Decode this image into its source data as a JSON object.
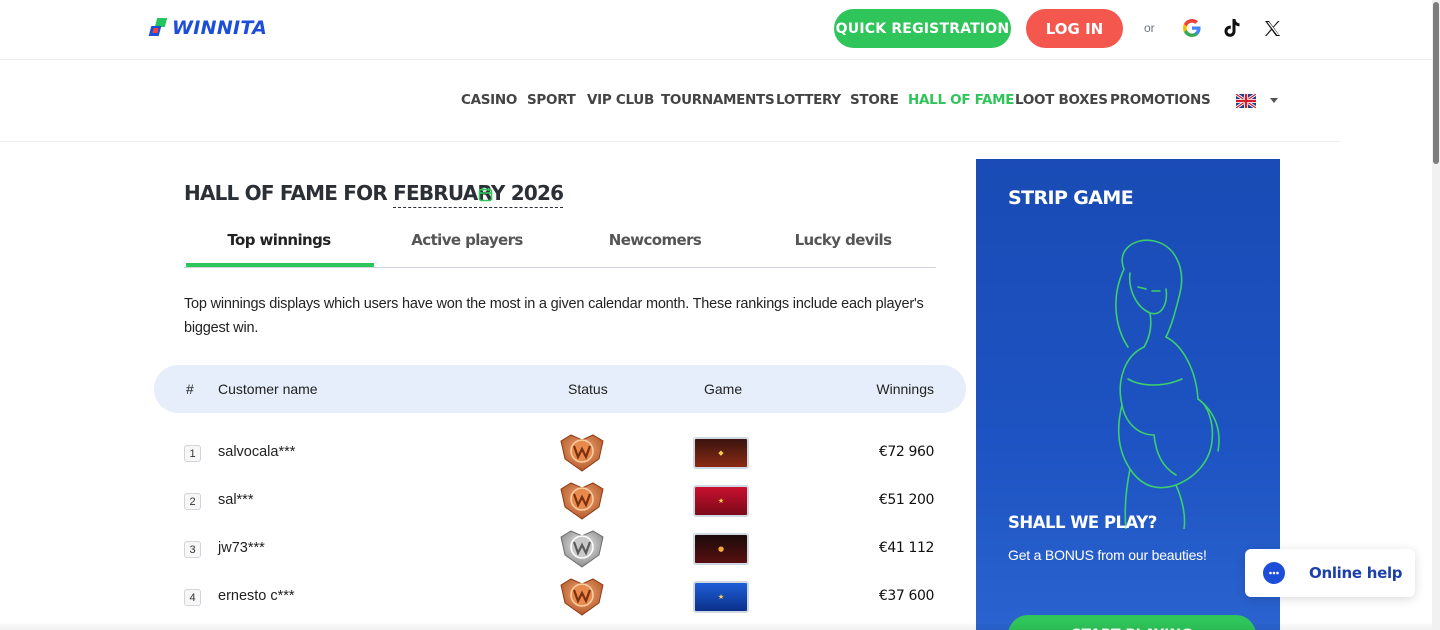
{
  "header": {
    "logo_text": "WINNITA",
    "register_label": "QUICK REGISTRATION",
    "login_label": "LOG IN",
    "or_text": "or",
    "social": [
      "google-icon",
      "tiktok-icon",
      "x-icon"
    ]
  },
  "nav": {
    "items": [
      {
        "label": "CASINO",
        "active": false
      },
      {
        "label": "SPORT",
        "active": false
      },
      {
        "label": "VIP CLUB",
        "active": false
      },
      {
        "label": "TOURNAMENTS",
        "active": false
      },
      {
        "label": "LOTTERY",
        "active": false
      },
      {
        "label": "STORE",
        "active": false
      },
      {
        "label": "HALL OF FAME",
        "active": true
      },
      {
        "label": "LOOT BOXES",
        "active": false
      },
      {
        "label": "PROMOTIONS",
        "active": false
      }
    ],
    "language_icon": "uk-flag-icon"
  },
  "main": {
    "title_prefix": "HALL OF FAME FOR",
    "title_month": "FEBRUARY 2026",
    "tabs": [
      {
        "label": "Top winnings",
        "active": true
      },
      {
        "label": "Active players",
        "active": false
      },
      {
        "label": "Newcomers",
        "active": false
      },
      {
        "label": "Lucky devils",
        "active": false
      }
    ],
    "description": "Top winnings displays which users have won the most in a given calendar month. These rankings include each player's biggest win.",
    "table": {
      "headers": {
        "rank": "#",
        "name": "Customer name",
        "status": "Status",
        "game": "Game",
        "winnings": "Winnings"
      },
      "rows": [
        {
          "rank": "1",
          "name": "salvocala***",
          "status": "bronze",
          "game": "game-thumbnail-1",
          "winnings": "€72 960"
        },
        {
          "rank": "2",
          "name": "sal***",
          "status": "bronze",
          "game": "game-thumbnail-2",
          "winnings": "€51 200"
        },
        {
          "rank": "3",
          "name": "jw73***",
          "status": "silver",
          "game": "game-thumbnail-3",
          "winnings": "€41 112"
        },
        {
          "rank": "4",
          "name": "ernesto c***",
          "status": "bronze",
          "game": "game-thumbnail-4",
          "winnings": "€37 600"
        }
      ]
    }
  },
  "banner": {
    "title": "STRIP GAME",
    "heading": "SHALL WE PLAY?",
    "text": "Get a BONUS from our beauties!",
    "button_label": "START PLAYING"
  },
  "help": {
    "label": "Online help"
  },
  "colors": {
    "accent_green": "#2fc55a",
    "login_red": "#f4574d",
    "brand_blue": "#1d4ed8",
    "banner_blue": "#1a4bb5"
  }
}
